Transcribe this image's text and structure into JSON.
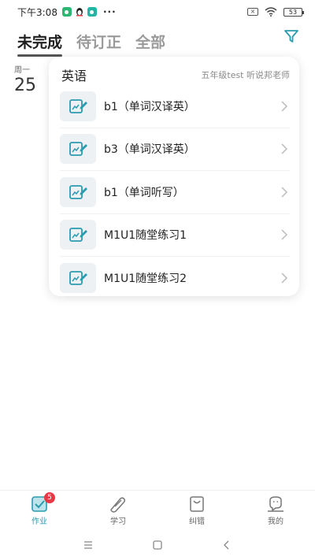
{
  "status_bar": {
    "time": "下午3:08",
    "more": "···",
    "battery": "53"
  },
  "tabs": [
    {
      "label": "未完成",
      "active": true
    },
    {
      "label": "待订正",
      "active": false
    },
    {
      "label": "全部",
      "active": false
    }
  ],
  "date": {
    "weekday": "周一",
    "day": "25"
  },
  "card": {
    "subject": "英语",
    "teacher_info": "五年级test 听说邦老师",
    "items": [
      {
        "title": "b1（单词汉译英）",
        "icon": "homework-edit-icon"
      },
      {
        "title": "b3（单词汉译英）",
        "icon": "homework-edit-icon"
      },
      {
        "title": "b1（单词听写）",
        "icon": "homework-edit-icon"
      },
      {
        "title": "M1U1随堂练习1",
        "icon": "homework-edit-icon"
      },
      {
        "title": "M1U1随堂练习2",
        "icon": "homework-edit-icon"
      }
    ]
  },
  "bottom_nav": [
    {
      "label": "作业",
      "icon": "homework-icon",
      "active": true,
      "badge": "5"
    },
    {
      "label": "学习",
      "icon": "study-icon",
      "active": false
    },
    {
      "label": "纠错",
      "icon": "correction-icon",
      "active": false
    },
    {
      "label": "我的",
      "icon": "profile-icon",
      "active": false
    }
  ],
  "colors": {
    "accent": "#2a9bb0",
    "badge": "#e63946",
    "icon_bg": "#eef1f3"
  }
}
